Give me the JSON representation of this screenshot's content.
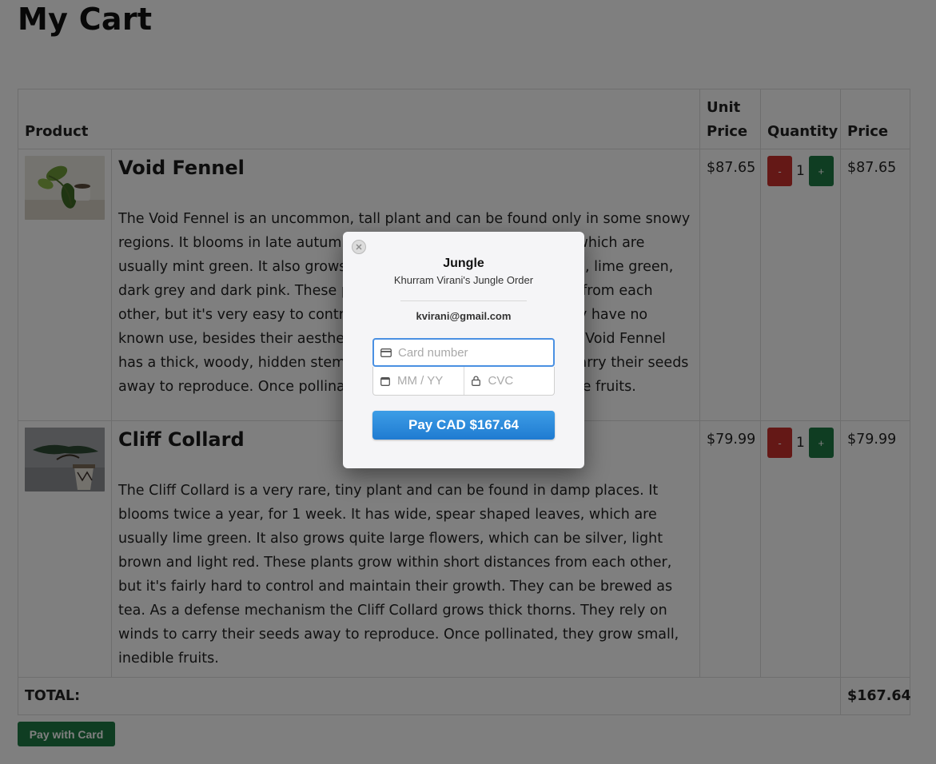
{
  "page": {
    "title": "My Cart"
  },
  "table": {
    "headers": {
      "product": "Product",
      "unit_price": "Unit Price",
      "quantity": "Quantity",
      "price": "Price"
    },
    "rows": [
      {
        "name": "Void Fennel",
        "description": "The Void Fennel is an uncommon, tall plant and can be found only in some snowy regions. It blooms in late autumn. It has long, needle-like leaves, which are usually mint green. It also grows large flowers, which can be white, lime green, dark grey and dark pink. These plants grow along short distances from each other, but it's very easy to control and maintain their growth. They have no known use, besides their aesthetics. As a defense mechanism the Void Fennel has a thick, woody, hidden stem. They rely on water currents to carry their seeds away to reproduce. Once pollinated, they grow fairly large, inedible fruits.",
        "unit_price": "$87.65",
        "quantity": "1",
        "price": "$87.65",
        "minus_label": "-",
        "plus_label": "+"
      },
      {
        "name": "Cliff Collard",
        "description": "The Cliff Collard is a very rare, tiny plant and can be found in damp places. It blooms twice a year, for 1 week. It has wide, spear shaped leaves, which are usually lime green. It also grows quite large flowers, which can be silver, light brown and light red. These plants grow within short distances from each other, but it's fairly hard to control and maintain their growth. They can be brewed as tea. As a defense mechanism the Cliff Collard grows thick thorns. They rely on winds to carry their seeds away to reproduce. Once pollinated, they grow small, inedible fruits.",
        "unit_price": "$79.99",
        "quantity": "1",
        "price": "$79.99",
        "minus_label": "-",
        "plus_label": "+"
      }
    ],
    "total_label": "TOTAL:",
    "total_value": "$167.64"
  },
  "pay_with_card_label": "Pay with Card",
  "checkout": {
    "merchant": "Jungle",
    "description": "Khurram Virani's Jungle Order",
    "email": "kvirani@gmail.com",
    "card_placeholder": "Card number",
    "expiry_placeholder": "MM / YY",
    "cvc_placeholder": "CVC",
    "pay_label": "Pay CAD $167.64",
    "close_icon": "close-icon",
    "accent": "#2a8ae0"
  },
  "colors": {
    "minus_button": "#c9302c",
    "plus_button": "#1f7a45",
    "pay_with_card_button": "#1f7a45"
  }
}
